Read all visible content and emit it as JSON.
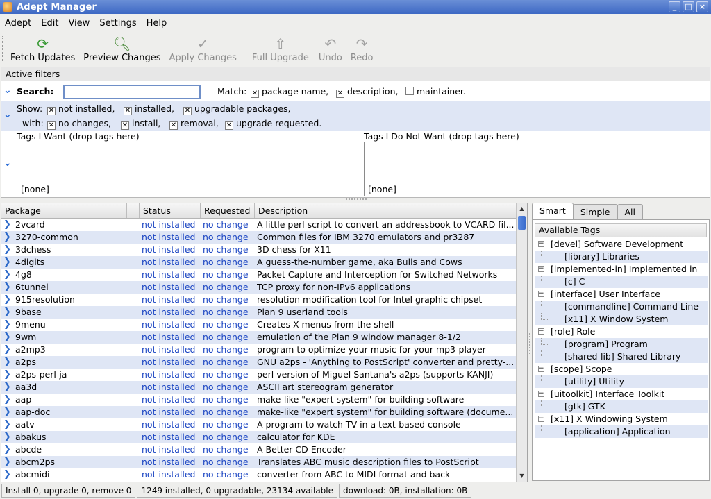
{
  "window": {
    "title": "Adept Manager"
  },
  "menubar": [
    "Adept",
    "Edit",
    "View",
    "Settings",
    "Help"
  ],
  "toolbar": {
    "fetch": "Fetch Updates",
    "preview": "Preview Changes",
    "apply": "Apply Changes",
    "upgrade": "Full Upgrade",
    "undo": "Undo",
    "redo": "Redo"
  },
  "filters": {
    "header": "Active filters",
    "search_label": "Search:",
    "search_value": "",
    "match_label": "Match:",
    "match": [
      {
        "label": "package name,",
        "checked": true
      },
      {
        "label": "description,",
        "checked": true
      },
      {
        "label": "maintainer.",
        "checked": false
      }
    ],
    "show_label": "Show:",
    "show": [
      {
        "label": "not installed,",
        "checked": true
      },
      {
        "label": "installed,",
        "checked": true
      },
      {
        "label": "upgradable packages,",
        "checked": true
      }
    ],
    "with_label": "with:",
    "with": [
      {
        "label": "no changes,",
        "checked": true
      },
      {
        "label": "install,",
        "checked": true
      },
      {
        "label": "removal,",
        "checked": true
      },
      {
        "label": "upgrade requested.",
        "checked": true
      }
    ],
    "tags_want": "Tags I Want (drop tags here)",
    "tags_dont": "Tags I Do Not Want (drop tags here)",
    "none": "[none]"
  },
  "packages": {
    "columns": [
      "Package",
      "Status",
      "Requested",
      "Description"
    ],
    "rows": [
      [
        "2vcard",
        "not installed",
        "no change",
        "A little perl script to convert an addressbook to VCARD fil..."
      ],
      [
        "3270-common",
        "not installed",
        "no change",
        "Common files for IBM 3270 emulators and pr3287"
      ],
      [
        "3dchess",
        "not installed",
        "no change",
        "3D chess for X11"
      ],
      [
        "4digits",
        "not installed",
        "no change",
        "A guess-the-number game, aka Bulls and Cows"
      ],
      [
        "4g8",
        "not installed",
        "no change",
        "Packet Capture and Interception for Switched Networks"
      ],
      [
        "6tunnel",
        "not installed",
        "no change",
        "TCP proxy for non-IPv6 applications"
      ],
      [
        "915resolution",
        "not installed",
        "no change",
        "resolution modification tool for Intel graphic chipset"
      ],
      [
        "9base",
        "not installed",
        "no change",
        "Plan 9 userland tools"
      ],
      [
        "9menu",
        "not installed",
        "no change",
        "Creates X menus from the shell"
      ],
      [
        "9wm",
        "not installed",
        "no change",
        "emulation of the Plan 9 window manager 8-1/2"
      ],
      [
        "a2mp3",
        "not installed",
        "no change",
        "program to optimize your music for your mp3-player"
      ],
      [
        "a2ps",
        "not installed",
        "no change",
        "GNU a2ps - 'Anything to PostScript' converter and pretty-..."
      ],
      [
        "a2ps-perl-ja",
        "not installed",
        "no change",
        "perl version of Miguel Santana's a2ps (supports KANJI)"
      ],
      [
        "aa3d",
        "not installed",
        "no change",
        "ASCII art stereogram generator"
      ],
      [
        "aap",
        "not installed",
        "no change",
        "make-like \"expert system\" for building software"
      ],
      [
        "aap-doc",
        "not installed",
        "no change",
        "make-like \"expert system\" for building software (docume..."
      ],
      [
        "aatv",
        "not installed",
        "no change",
        "A program to watch TV in a text-based console"
      ],
      [
        "abakus",
        "not installed",
        "no change",
        "calculator for KDE"
      ],
      [
        "abcde",
        "not installed",
        "no change",
        "A Better CD Encoder"
      ],
      [
        "abcm2ps",
        "not installed",
        "no change",
        "Translates ABC music description files to PostScript"
      ],
      [
        "abcmidi",
        "not installed",
        "no change",
        "converter from ABC to MIDI format and back"
      ]
    ]
  },
  "tagpanel": {
    "tabs": [
      "Smart",
      "Simple",
      "All"
    ],
    "header": "Available Tags",
    "tree": [
      {
        "text": "[devel] Software Development",
        "child": false
      },
      {
        "text": "[library] Libraries",
        "child": true
      },
      {
        "text": "[implemented-in] Implemented in",
        "child": false
      },
      {
        "text": "[c] C",
        "child": true
      },
      {
        "text": "[interface] User Interface",
        "child": false
      },
      {
        "text": "[commandline] Command Line",
        "child": true
      },
      {
        "text": "[x11] X Window System",
        "child": true
      },
      {
        "text": "[role] Role",
        "child": false
      },
      {
        "text": "[program] Program",
        "child": true
      },
      {
        "text": "[shared-lib] Shared Library",
        "child": true
      },
      {
        "text": "[scope] Scope",
        "child": false
      },
      {
        "text": "[utility] Utility",
        "child": true
      },
      {
        "text": "[uitoolkit] Interface Toolkit",
        "child": false
      },
      {
        "text": "[gtk] GTK",
        "child": true
      },
      {
        "text": "[x11] X Windowing System",
        "child": false
      },
      {
        "text": "[application] Application",
        "child": true
      }
    ]
  },
  "statusbar": {
    "changes": "Install 0, upgrade 0, remove 0",
    "counts": "1249 installed, 0 upgradable, 23134 available",
    "sizes": "download: 0B, installation: 0B"
  }
}
